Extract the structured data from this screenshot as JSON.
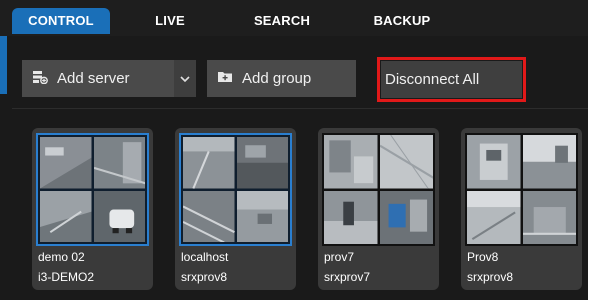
{
  "tabs": [
    {
      "label": "CONTROL",
      "active": true
    },
    {
      "label": "LIVE",
      "active": false
    },
    {
      "label": "SEARCH",
      "active": false
    },
    {
      "label": "BACKUP",
      "active": false
    }
  ],
  "toolbar": {
    "add_server_label": "Add server",
    "add_group_label": "Add group",
    "disconnect_all_label": "Disconnect All"
  },
  "servers": [
    {
      "name": "demo 02",
      "host": "i3-DEMO2",
      "selected": true
    },
    {
      "name": "localhost",
      "host": "srxprov8",
      "selected": true
    },
    {
      "name": "prov7",
      "host": "srxprov7",
      "selected": false
    },
    {
      "name": "Prov8",
      "host": "srxprov8",
      "selected": false
    }
  ],
  "colors": {
    "accent": "#1a6fb8",
    "highlight_border": "#e11919",
    "background": "#1a1a1a"
  },
  "icons": {
    "add_server": "server-add-icon",
    "add_group": "folder-add-icon",
    "dropdown": "chevron-down-icon"
  }
}
